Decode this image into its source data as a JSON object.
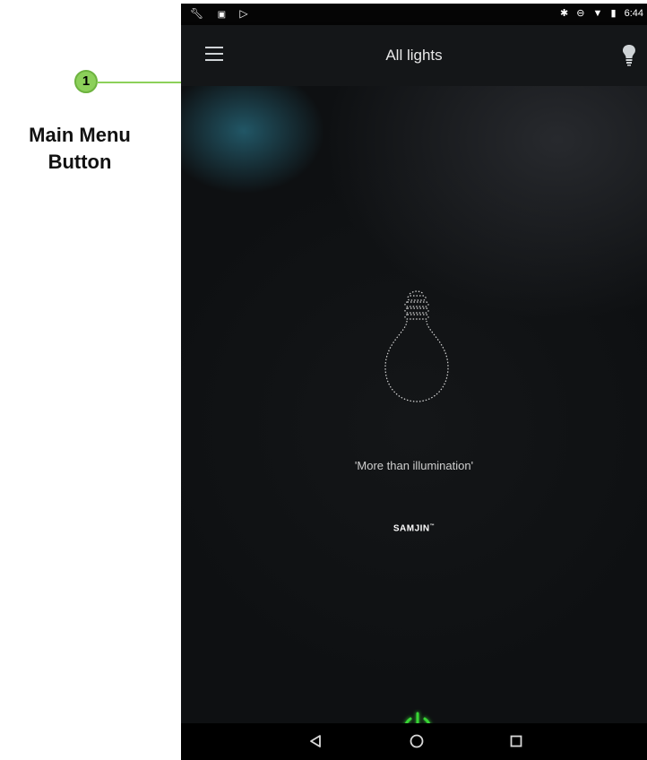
{
  "annotation": {
    "number": "1",
    "label": "Main Menu\nButton"
  },
  "status_bar": {
    "left_icons": [
      "wrench-icon",
      "image-icon",
      "cast-icon"
    ],
    "right_icons": [
      "bluetooth-icon",
      "do-not-disturb-icon",
      "wifi-icon",
      "battery-icon"
    ],
    "time": "6:44"
  },
  "app_bar": {
    "title": "All lights",
    "menu_icon": "hamburger-icon",
    "right_icon": "bulb-icon"
  },
  "main": {
    "tagline": "'More than illumination'",
    "brand": "SAMJIN",
    "brand_mark": "™",
    "power_icon": "power-icon",
    "power_color": "#39d634"
  },
  "nav_bar": {
    "buttons": [
      "back-icon",
      "home-icon",
      "recents-icon"
    ]
  },
  "colors": {
    "accent_green": "#8cd05a",
    "app_bar_bg": "#141618",
    "glow_teal": "#286e82"
  }
}
